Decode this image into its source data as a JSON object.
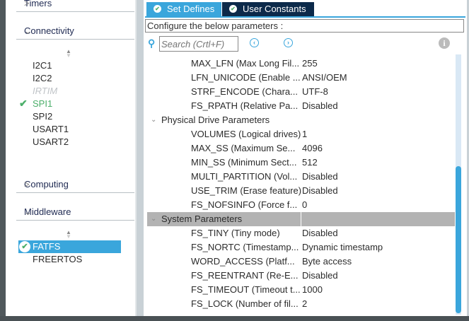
{
  "sidebar": {
    "categories": [
      {
        "label": "Timers"
      },
      {
        "label": "Connectivity"
      },
      {
        "label": "Computing"
      },
      {
        "label": "Middleware"
      }
    ],
    "connectivity_items": [
      {
        "label": "I2C1"
      },
      {
        "label": "I2C2"
      },
      {
        "label": "IRTIM"
      },
      {
        "label": "SPI1"
      },
      {
        "label": "SPI2"
      },
      {
        "label": "USART1"
      },
      {
        "label": "USART2"
      }
    ],
    "middleware_items": [
      {
        "label": "FATFS"
      },
      {
        "label": "FREERTOS"
      }
    ]
  },
  "tabs": [
    {
      "label": "Set Defines"
    },
    {
      "label": "User Constants"
    }
  ],
  "config_label": "Configure the below parameters :",
  "search": {
    "placeholder": "Search (Crtl+F)"
  },
  "colors": {
    "accent": "#3aa6dc",
    "tab_dark": "#0c2a4a",
    "enabled": "#4caf6a"
  },
  "params": [
    {
      "label": "MAX_LFN (Max Long Fil...",
      "value": "255"
    },
    {
      "label": "LFN_UNICODE (Enable ...",
      "value": "ANSI/OEM"
    },
    {
      "label": "STRF_ENCODE (Chara...",
      "value": "UTF-8"
    },
    {
      "label": "FS_RPATH (Relative Pa...",
      "value": "Disabled"
    },
    {
      "group": "Physical Drive Parameters"
    },
    {
      "label": "VOLUMES (Logical drives)",
      "value": "1"
    },
    {
      "label": "MAX_SS (Maximum Se...",
      "value": "4096"
    },
    {
      "label": "MIN_SS (Minimum Sect...",
      "value": "512"
    },
    {
      "label": "MULTI_PARTITION (Vol...",
      "value": "Disabled"
    },
    {
      "label": "USE_TRIM (Erase feature)",
      "value": "Disabled"
    },
    {
      "label": "FS_NOFSINFO (Force f...",
      "value": "0"
    },
    {
      "group": "System Parameters",
      "selected": true
    },
    {
      "label": "FS_TINY (Tiny mode)",
      "value": "Disabled"
    },
    {
      "label": "FS_NORTC (Timestamp...",
      "value": "Dynamic timestamp"
    },
    {
      "label": "WORD_ACCESS (Platf...",
      "value": "Byte access"
    },
    {
      "label": "FS_REENTRANT (Re-E...",
      "value": "Disabled"
    },
    {
      "label": "FS_TIMEOUT (Timeout t...",
      "value": "1000"
    },
    {
      "label": "FS_LOCK (Number of fil...",
      "value": "2"
    }
  ]
}
